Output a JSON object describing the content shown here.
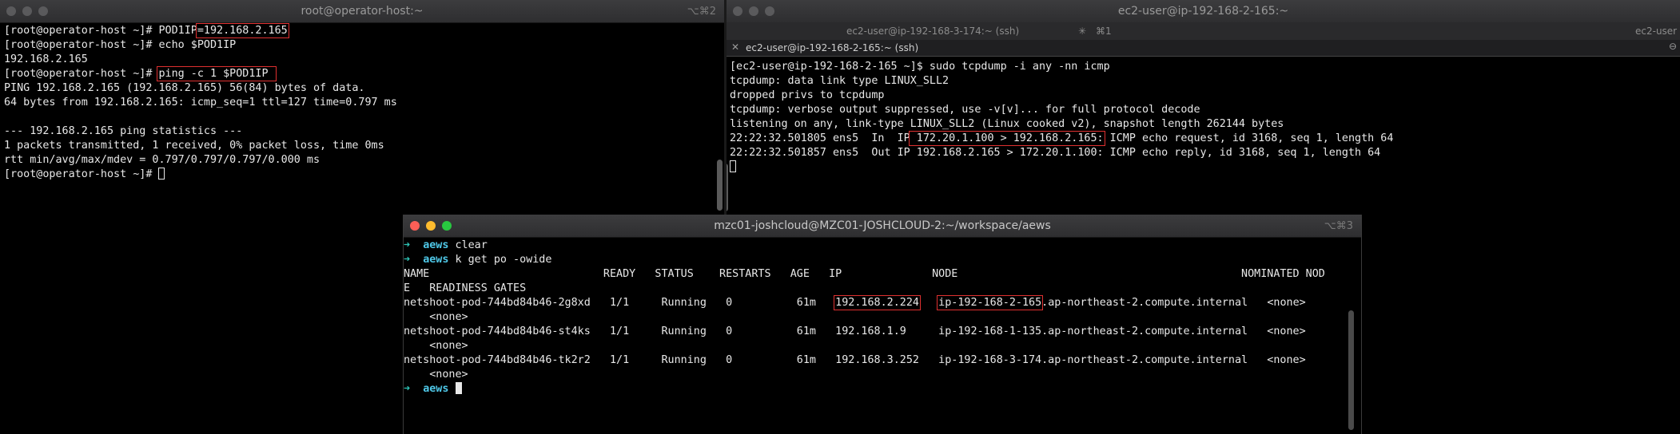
{
  "left_window": {
    "title": "root@operator-host:~",
    "shortcut": "⌥⌘2",
    "lines": {
      "l1_prompt": "[root@operator-host ~]# ",
      "l1_cmd": "POD1IP",
      "l1_val": "=192.168.2.165",
      "l2": "[root@operator-host ~]# echo $POD1IP",
      "l3": "192.168.2.165",
      "l4_prompt": "[root@operator-host ~]# ",
      "l4_cmd": "ping -c 1 $POD1IP ",
      "l5": "PING 192.168.2.165 (192.168.2.165) 56(84) bytes of data.",
      "l6": "64 bytes from 192.168.2.165: icmp_seq=1 ttl=127 time=0.797 ms",
      "l7": "",
      "l8": "--- 192.168.2.165 ping statistics ---",
      "l9": "1 packets transmitted, 1 received, 0% packet loss, time 0ms",
      "l10": "rtt min/avg/max/mdev = 0.797/0.797/0.797/0.000 ms",
      "l11_prompt": "[root@operator-host ~]# "
    }
  },
  "right_window": {
    "title": "ec2-user@ip-192-168-2-165:~",
    "tabs": {
      "tab1": "ec2-user@ip-192-168-3-174:~ (ssh)",
      "tab1_shortcut": "⌘1",
      "tab2": "ec2-user"
    },
    "active_tab": "ec2-user@ip-192-168-2-165:~ (ssh)",
    "lines": {
      "l1": "[ec2-user@ip-192-168-2-165 ~]$ sudo tcpdump -i any -nn icmp",
      "l2": "tcpdump: data link type LINUX_SLL2",
      "l3": "dropped privs to tcpdump",
      "l4": "tcpdump: verbose output suppressed, use -v[v]... for full protocol decode",
      "l5": "listening on any, link-type LINUX_SLL2 (Linux cooked v2), snapshot length 262144 bytes",
      "l6_a": "22:22:32.501805 ens5  In  IP",
      "l6_b": " 172.20.1.100 > 192.168.2.165:",
      "l6_c": " ICMP echo request, id 3168, seq 1, length 64",
      "l7": "22:22:32.501857 ens5  Out IP 192.168.2.165 > 172.20.1.100: ICMP echo reply, id 3168, seq 1, length 64"
    }
  },
  "front_window": {
    "title": "mzc01-joshcloud@MZC01-JOSHCLOUD-2:~/workspace/aews",
    "shortcut": "⌥⌘3",
    "prompt_arrow": "➜",
    "dir": "aews",
    "cmd1": " clear",
    "cmd2": " k get po -owide",
    "header1": "NAME                           READY   STATUS    RESTARTS   AGE   IP              NODE                                            NOMINATED NOD",
    "header2": "E   READINESS GATES",
    "rows": [
      {
        "name_ready_status": "netshoot-pod-744bd84b46-2g8xd   1/1     Running   0          61m   ",
        "ip": "192.168.2.224",
        "gap": "   ",
        "node_hl": "ip-192-168-2-165",
        "node_rest": ".ap-northeast-2.compute.internal   <none>",
        "cont": "    <none>"
      },
      {
        "line": "netshoot-pod-744bd84b46-st4ks   1/1     Running   0          61m   192.168.1.9     ip-192-168-1-135.ap-northeast-2.compute.internal   <none>",
        "cont": "    <none>"
      },
      {
        "line": "netshoot-pod-744bd84b46-tk2r2   1/1     Running   0          61m   192.168.3.252   ip-192-168-3-174.ap-northeast-2.compute.internal   <none>",
        "cont": "    <none>"
      }
    ]
  }
}
